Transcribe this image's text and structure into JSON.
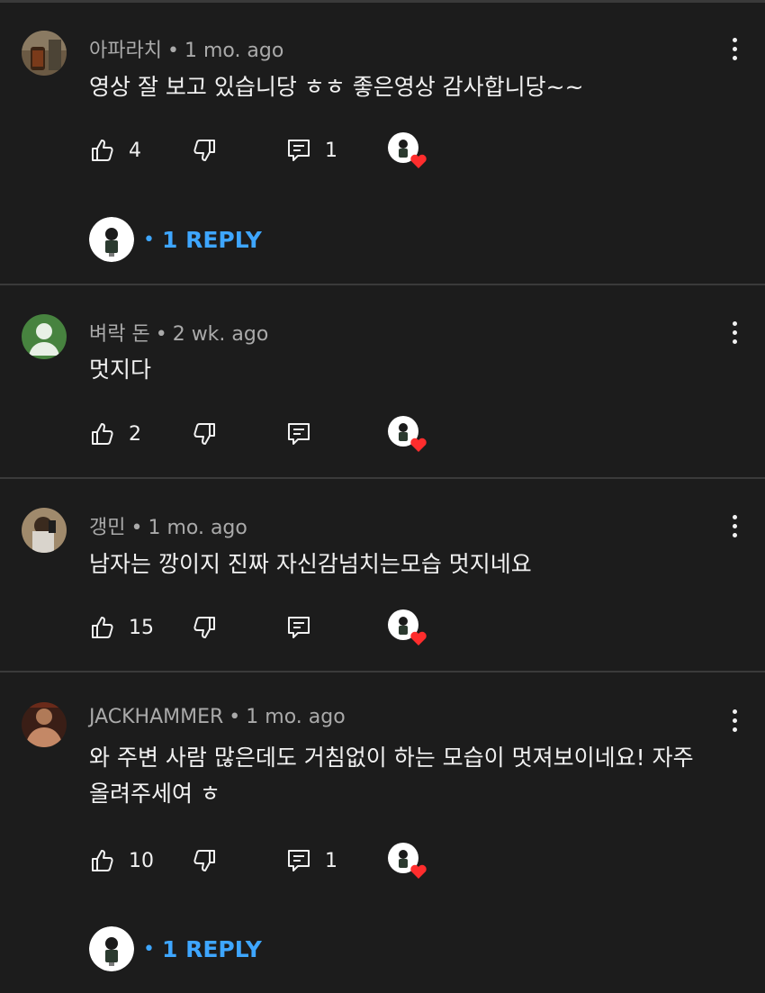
{
  "comments": [
    {
      "author": "아파라치",
      "time": "1 mo. ago",
      "text": "영상 잘 보고 있습니당 ㅎㅎ 좋은영상 감사합니당~~",
      "likes": "4",
      "replies_count": "1",
      "reply_link": "1 REPLY"
    },
    {
      "author": "벼락 돈",
      "time": "2 wk. ago",
      "text": "멋지다",
      "likes": "2"
    },
    {
      "author": "갱민",
      "time": "1 mo. ago",
      "text": "남자는 깡이지 진짜 자신감넘치는모습 멋지네요",
      "likes": "15"
    },
    {
      "author": "JACKHAMMER",
      "time": "1 mo. ago",
      "text_line1": "와 주변 사람 많은데도 거침없이 하는 모습이 멋져보이네요! 자주",
      "text_line2": "올려주세여 ㅎ",
      "likes": "10",
      "replies_count": "1",
      "reply_link": "1 REPLY"
    }
  ],
  "icons": {
    "like": "thumbs-up-icon",
    "dislike": "thumbs-down-icon",
    "reply": "comment-icon",
    "more": "more-vert-icon",
    "creator_heart": "creator-heart-icon"
  },
  "colors": {
    "background": "#1c1c1c",
    "link": "#3ea6ff",
    "heart": "#ff2d2d",
    "meta": "#aaaaaa"
  }
}
